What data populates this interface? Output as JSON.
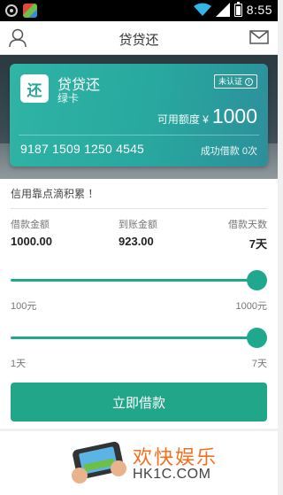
{
  "status_bar": {
    "time": "8:55"
  },
  "header": {
    "title": "贷贷还"
  },
  "card": {
    "logo_char": "还",
    "app_name": "贷贷还",
    "card_type": "绿卡",
    "verify_label": "未认证",
    "available_label": "可用额度 ¥",
    "available_amount": "1000",
    "card_number": "9187 1509 1250 4545",
    "success_label": "成功借款 0次"
  },
  "credit": {
    "title": "信用靠点滴积累 ！"
  },
  "loan": {
    "borrow_label": "借款金额",
    "borrow_value": "1000.00",
    "received_label": "到账金额",
    "received_value": "923.00",
    "days_label": "借款天数",
    "days_value": "7天"
  },
  "amount_slider": {
    "min_label": "100元",
    "max_label": "1000元",
    "value_fraction": 1.0
  },
  "days_slider": {
    "min_label": "1天",
    "max_label": "7天",
    "value_fraction": 1.0
  },
  "borrow_button": {
    "label": "立即借款"
  },
  "promo": {
    "brand": "欢快娱乐",
    "domain": "HK1C.COM"
  },
  "colors": {
    "accent": "#21a68a",
    "card": "#2aa597",
    "brand_orange": "#f36f20"
  },
  "icons": [
    "user-icon",
    "mail-icon",
    "wifi-icon",
    "signal-icon",
    "battery-icon",
    "info-icon"
  ]
}
